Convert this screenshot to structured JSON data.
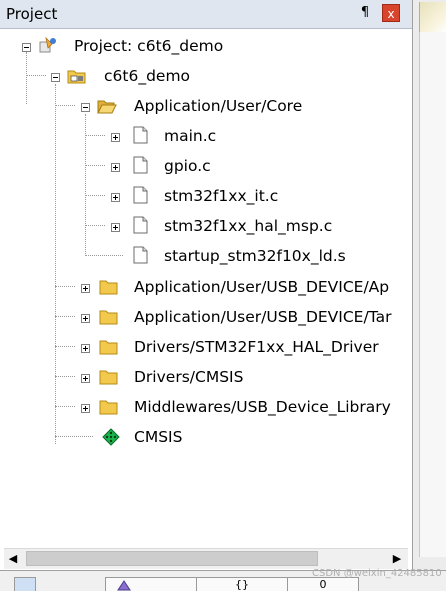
{
  "panel": {
    "title": "Project",
    "pin_label": "¶",
    "close_label": "x"
  },
  "tree": {
    "root": "Project: c6t6_demo",
    "target": "c6t6_demo",
    "groups": [
      {
        "label": "Application/User/Core",
        "expanded": true,
        "files": [
          {
            "label": "main.c",
            "expandable": true
          },
          {
            "label": "gpio.c",
            "expandable": true
          },
          {
            "label": "stm32f1xx_it.c",
            "expandable": true
          },
          {
            "label": "stm32f1xx_hal_msp.c",
            "expandable": true
          },
          {
            "label": "startup_stm32f10x_ld.s",
            "expandable": false
          }
        ]
      },
      {
        "label": "Application/User/USB_DEVICE/Ap",
        "expanded": false
      },
      {
        "label": "Application/User/USB_DEVICE/Tar",
        "expanded": false
      },
      {
        "label": "Drivers/STM32F1xx_HAL_Driver",
        "expanded": false
      },
      {
        "label": "Drivers/CMSIS",
        "expanded": false
      },
      {
        "label": "Middlewares/USB_Device_Library",
        "expanded": false
      }
    ],
    "cmsis": "CMSIS"
  },
  "scrollbar": {
    "left_arrow": "◀",
    "right_arrow": "▶"
  },
  "bottom_tabs": [
    {
      "label": ""
    },
    {
      "label": "{}"
    },
    {
      "label": "0"
    }
  ],
  "watermark": "CSDN @weixin_42485810",
  "colors": {
    "titlebar": "#dfe6ef",
    "close": "#d9442c",
    "folder": "#f2c94c",
    "cmsis_green": "#19b44a"
  }
}
